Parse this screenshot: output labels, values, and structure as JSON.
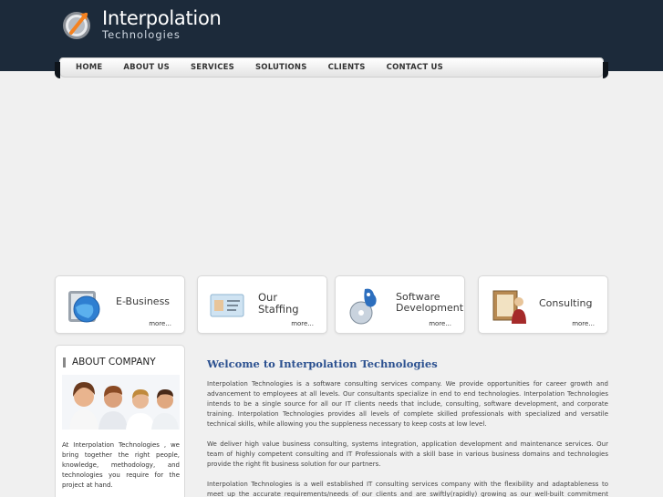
{
  "logo": {
    "name": "Interpolation",
    "sub": "Technologies"
  },
  "nav": [
    "HOME",
    "ABOUT US",
    "SERVICES",
    "SOLUTIONS",
    "CLIENTS",
    "CONTACT US"
  ],
  "boxes": [
    {
      "title": "E-Business",
      "more": "more...",
      "icon": "globe-icon"
    },
    {
      "title": "Our\nStaffing",
      "more": "more...",
      "icon": "id-card-icon"
    },
    {
      "title": "Software\nDevelopment",
      "more": "more...",
      "icon": "software-cd-icon"
    },
    {
      "title": "Consulting",
      "more": "more...",
      "icon": "consultant-icon"
    }
  ],
  "about": {
    "title": "ABOUT COMPANY",
    "text": "At Interpolation Technologies , we bring together the right people, knowledge, methodology, and technologies you require for the project at hand."
  },
  "welcome": "Welcome to Interpolation Technologies",
  "paragraphs": [
    "Interpolation Technologies is a software consulting services company. We provide opportunities for career growth and advancement to employees at all levels. Our consultants specialize in end to end technologies. Interpolation Technologies intends to be a single source for all our IT clients needs that include, consulting, software development, and corporate training. Interpolation Technologies provides all levels of complete skilled professionals with specialized and versatile technical skills, while allowing you the suppleness necessary to keep costs at low level.",
    "We deliver high value business consulting, systems integration, application development and maintenance services. Our team of highly competent consulting and IT Professionals with a skill base in various business domains and technologies provide the right fit business solution for our partners.",
    "Interpolation Technologies is a well established IT consulting services company with the flexibility and adaptableness to meet up the accurate requirements/needs of our clients and are swiftly(rapidly) growing as our well-built commitment towards our"
  ]
}
